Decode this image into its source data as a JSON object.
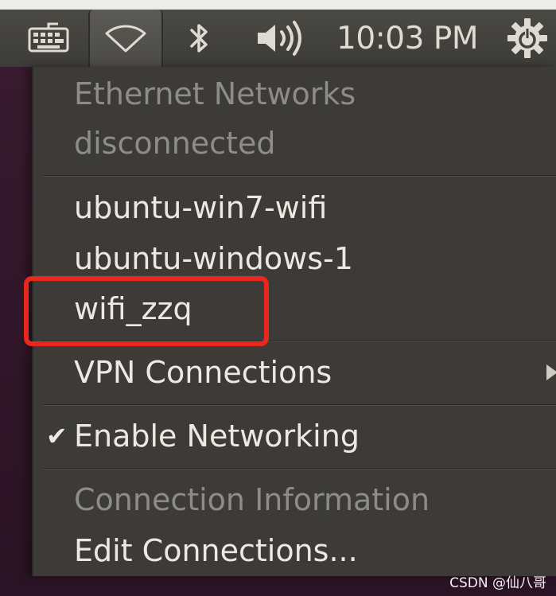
{
  "panel": {
    "clock": "10:03 PM",
    "icons": {
      "keyboard": "keyboard-icon",
      "network": "wifi-icon",
      "bluetooth": "bluetooth-icon",
      "volume": "volume-icon",
      "power": "gear-power-icon"
    }
  },
  "menu": {
    "ethernet_header": "Ethernet Networks",
    "ethernet_status": "disconnected",
    "networks": [
      "ubuntu-win7-wifi",
      "ubuntu-windows-1",
      "wifi_zzq"
    ],
    "vpn": "VPN Connections",
    "enable_networking": "Enable Networking",
    "enable_networking_checked": true,
    "connection_info": "Connection Information",
    "edit_connections": "Edit Connections..."
  },
  "annotation": {
    "color": "#e8281d"
  },
  "watermark": "CSDN @仙八哥"
}
